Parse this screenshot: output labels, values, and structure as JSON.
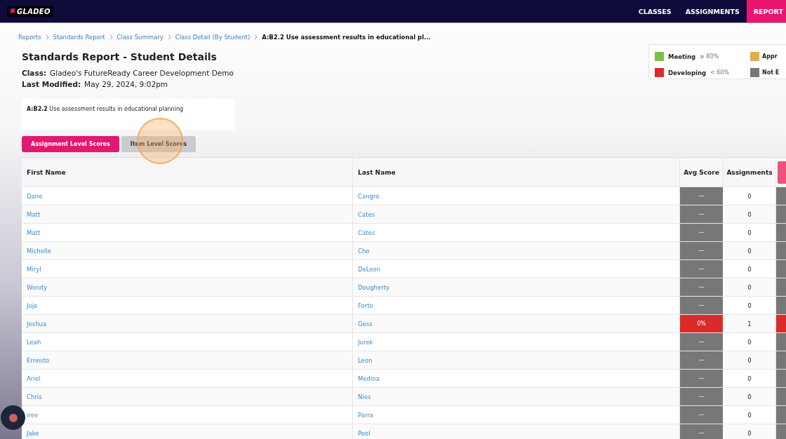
{
  "topbar": {
    "logo": "GLADEO",
    "nav": [
      {
        "label": "CLASSES",
        "selected": false
      },
      {
        "label": "ASSIGNMENTS",
        "selected": false
      },
      {
        "label": "REPORT",
        "selected": true
      }
    ]
  },
  "breadcrumbs": [
    {
      "label": "Reports",
      "current": false
    },
    {
      "label": "Standards Report",
      "current": false
    },
    {
      "label": "Class Summary",
      "current": false
    },
    {
      "label": "Class Detail (By Student)",
      "current": false
    },
    {
      "label": "A:B2.2 Use assessment results in educational pl...",
      "current": true
    }
  ],
  "title": "Standards Report - Student Details",
  "meta": [
    {
      "label": "Class:",
      "value": "Gladeo's FutureReady Career Development Demo"
    },
    {
      "label": "Last Modified:",
      "value": "May 29, 2024, 9:02pm"
    }
  ],
  "legend": [
    {
      "label": "Meeting",
      "range": "≥ 80%",
      "color": "#7cc142"
    },
    {
      "label": "Appr",
      "color": "#e3ac4c"
    },
    {
      "label": "Developing",
      "range": "< 60%",
      "color": "#dc2a2a"
    },
    {
      "label": "Not E",
      "color": "#777777"
    }
  ],
  "standard": "**A:B2.2** Use assessment results in educational planning",
  "view_buttons": [
    {
      "label": "Assignment Level Scores",
      "selected": true
    },
    {
      "label": "Item Level Scores",
      "selected": false
    }
  ],
  "table": {
    "columns": [
      "First Name",
      "Last Name",
      "Avg Score",
      "Assignments"
    ],
    "rows": [
      {
        "first": "Dane",
        "last": "Cangro",
        "avg": "—",
        "assignments": "0",
        "color": "#777777"
      },
      {
        "first": "Matt",
        "last": "Cates",
        "avg": "—",
        "assignments": "0",
        "color": "#777777"
      },
      {
        "first": "Matt",
        "last": "Cates",
        "avg": "—",
        "assignments": "0",
        "color": "#777777"
      },
      {
        "first": "Michelle",
        "last": "Cho",
        "avg": "—",
        "assignments": "0",
        "color": "#777777"
      },
      {
        "first": "Miryl",
        "last": "DeLeon",
        "avg": "—",
        "assignments": "0",
        "color": "#777777"
      },
      {
        "first": "Wendy",
        "last": "Dougherty",
        "avg": "—",
        "assignments": "0",
        "color": "#777777"
      },
      {
        "first": "Jojo",
        "last": "Forte",
        "avg": "—",
        "assignments": "0",
        "color": "#777777"
      },
      {
        "first": "Joshua",
        "last": "Gess",
        "avg": "0%",
        "assignments": "1",
        "color": "#dc2a2a"
      },
      {
        "first": "Leah",
        "last": "Jurek",
        "avg": "—",
        "assignments": "0",
        "color": "#777777"
      },
      {
        "first": "Ernesto",
        "last": "Leon",
        "avg": "—",
        "assignments": "0",
        "color": "#777777"
      },
      {
        "first": "Ariel",
        "last": "Medina",
        "avg": "—",
        "assignments": "0",
        "color": "#777777"
      },
      {
        "first": "Chris",
        "last": "Nies",
        "avg": "—",
        "assignments": "0",
        "color": "#777777"
      },
      {
        "first": "iree",
        "last": "Parra",
        "avg": "—",
        "assignments": "0",
        "color": "#777777"
      },
      {
        "first": "Jake",
        "last": "Pool",
        "avg": "—",
        "assignments": "0",
        "color": "#777777"
      }
    ]
  }
}
